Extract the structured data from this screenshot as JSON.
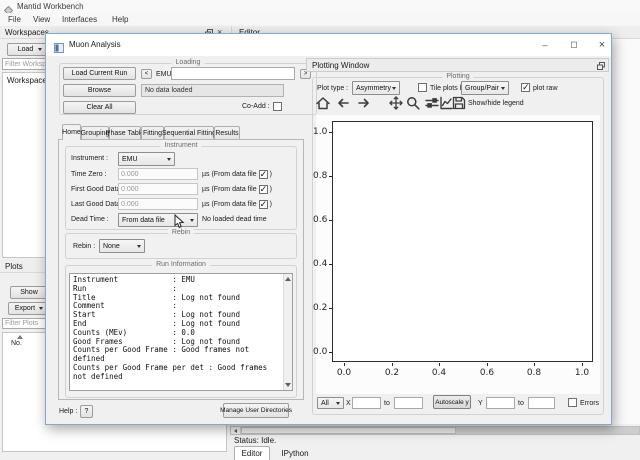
{
  "main": {
    "title": "Mantid Workbench",
    "menus": [
      "File",
      "View",
      "Interfaces",
      "Help"
    ],
    "workspaces_dock": {
      "title": "Workspaces",
      "load_button": "Load",
      "filter_placeholder": "Filter Workspaces",
      "tree_root": "Workspaces"
    },
    "plots_dock": {
      "title": "Plots",
      "show_button": "Show",
      "export_button": "Export",
      "filter_placeholder": "Filter Plots",
      "number_column": "No."
    },
    "editor_dock_title": "Editor",
    "status": "Status: Idle.",
    "bottom_tabs": [
      "Editor",
      "IPython"
    ]
  },
  "muon": {
    "title": "Muon Analysis",
    "window_buttons": {
      "minimize": "–",
      "maximize": "◻",
      "close": "×"
    },
    "loading": {
      "legend": "Loading",
      "load_current_run": "Load Current Run",
      "prev": "<",
      "next": ">",
      "instrument_prefix": "EMU",
      "run_value": "",
      "browse": "Browse",
      "status": "No data loaded",
      "clear_all": "Clear All",
      "coadd_label": "Co-Add :"
    },
    "tabs": [
      "Home",
      "Grouping",
      "Phase Table",
      "Fitting",
      "Sequential Fitting",
      "Results"
    ],
    "instrument": {
      "legend": "Instrument",
      "instrument_label": "Instrument :",
      "instrument_value": "EMU",
      "time_zero_label": "Time Zero :",
      "time_zero_value": "0.000",
      "first_good_label": "First Good Data :",
      "first_good_value": "0.000",
      "last_good_label": "Last Good Data :",
      "last_good_value": "0.000",
      "file_suffix_pre": "µs (From data file",
      "file_suffix_post": ")",
      "dead_time_label": "Dead Time :",
      "dead_time_value": "From data file",
      "dead_time_note": "No loaded dead time"
    },
    "rebin": {
      "legend": "Rebin",
      "label": "Rebin :",
      "value": "None"
    },
    "run_info": {
      "legend": "Run Information",
      "lines": [
        "Instrument            : EMU",
        "Run                   :",
        "Title                 : Log not found",
        "Comment               :",
        "Start                 : Log not found",
        "End                   : Log not found",
        "Counts (MEv)          : 0.0",
        "Good Frames           : Log not found",
        "Counts per Good Frame : Good frames not",
        "defined",
        "Counts per Good Frame per det : Good frames",
        "not defined"
      ]
    },
    "help_label": "Help :",
    "help_button": "?",
    "manage_dirs_button": "Manage User Directories"
  },
  "plotting": {
    "title": "Plotting Window",
    "legend": "Plotting",
    "plot_type_label": "Plot type :",
    "plot_type_value": "Asymmetry",
    "tile_label": "Tile plots by:",
    "tile_value": "Group/Pair",
    "plot_raw_label": "plot raw",
    "show_hide_legend": "Show/hide legend",
    "range_bar": {
      "selector": "All",
      "x_label": "X",
      "to_label": "to",
      "x_from": "",
      "x_to": "",
      "autoscale_button": "Autoscale y",
      "y_label": "Y",
      "y_from": "",
      "y_to": "",
      "errors_label": "Errors"
    }
  },
  "chart_data": {
    "type": "line",
    "title": "",
    "xlabel": "",
    "ylabel": "",
    "series": [],
    "xlim": [
      -0.05,
      1.05
    ],
    "ylim": [
      -0.05,
      1.05
    ],
    "grid": false,
    "xticks": [
      "0.0",
      "0.2",
      "0.4",
      "0.6",
      "0.8",
      "1.0"
    ],
    "yticks": [
      "1.0",
      "0.8",
      "0.6",
      "0.4",
      "0.2",
      "0.0"
    ]
  }
}
